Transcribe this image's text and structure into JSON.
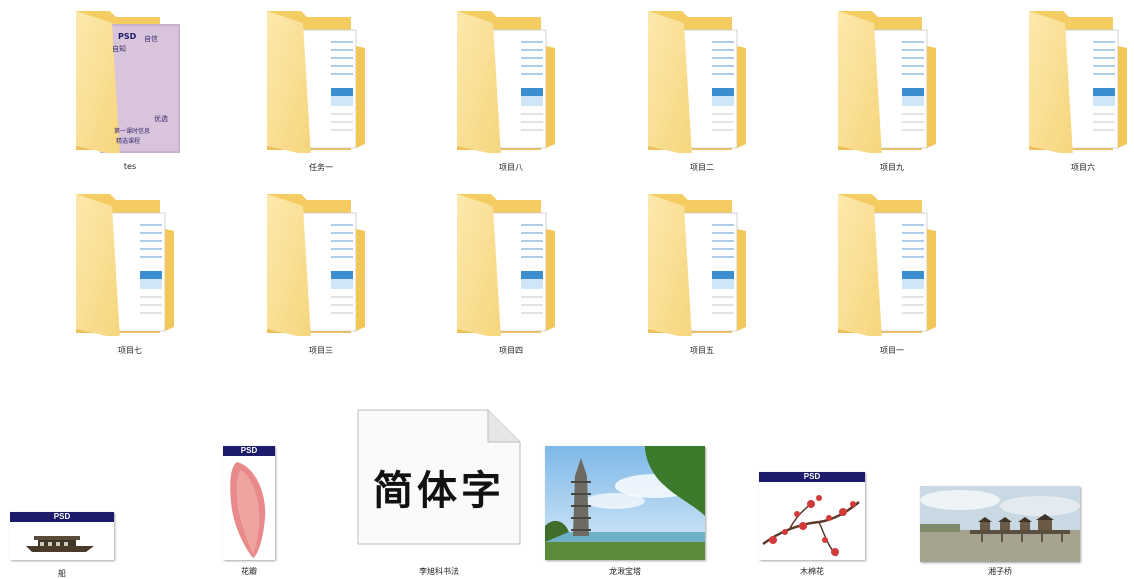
{
  "folders": [
    {
      "label": "tes",
      "icon": "folder-icon"
    },
    {
      "label": "任务一",
      "icon": "folder-icon"
    },
    {
      "label": "项目八",
      "icon": "folder-icon"
    },
    {
      "label": "项目二",
      "icon": "folder-icon"
    },
    {
      "label": "项目九",
      "icon": "folder-icon"
    },
    {
      "label": "项目六",
      "icon": "folder-icon"
    },
    {
      "label": "项目七",
      "icon": "folder-icon"
    },
    {
      "label": "项目三",
      "icon": "folder-icon"
    },
    {
      "label": "项目四",
      "icon": "folder-icon"
    },
    {
      "label": "项目五",
      "icon": "folder-icon"
    },
    {
      "label": "项目一",
      "icon": "folder-icon"
    }
  ],
  "tes_folder_preview": {
    "badge": "PSD",
    "title": "自信",
    "subtitle": "自知",
    "caption": "优选",
    "footer_1": "第一课时信息",
    "footer_2": "精选课程"
  },
  "files": [
    {
      "label": "船",
      "type": "psd",
      "badge": "PSD"
    },
    {
      "label": "花瓣",
      "type": "psd",
      "badge": "PSD"
    },
    {
      "label": "李旭科书法",
      "type": "document",
      "sample_text": "简体字"
    },
    {
      "label": "龙湫宝塔",
      "type": "image"
    },
    {
      "label": "木棉花",
      "type": "psd",
      "badge": "PSD"
    },
    {
      "label": "湘子桥",
      "type": "image"
    }
  ],
  "colors": {
    "folder_back": "#f3cf6b",
    "folder_front": "#fbe3a0",
    "psd_band": "#1d1b6b"
  }
}
